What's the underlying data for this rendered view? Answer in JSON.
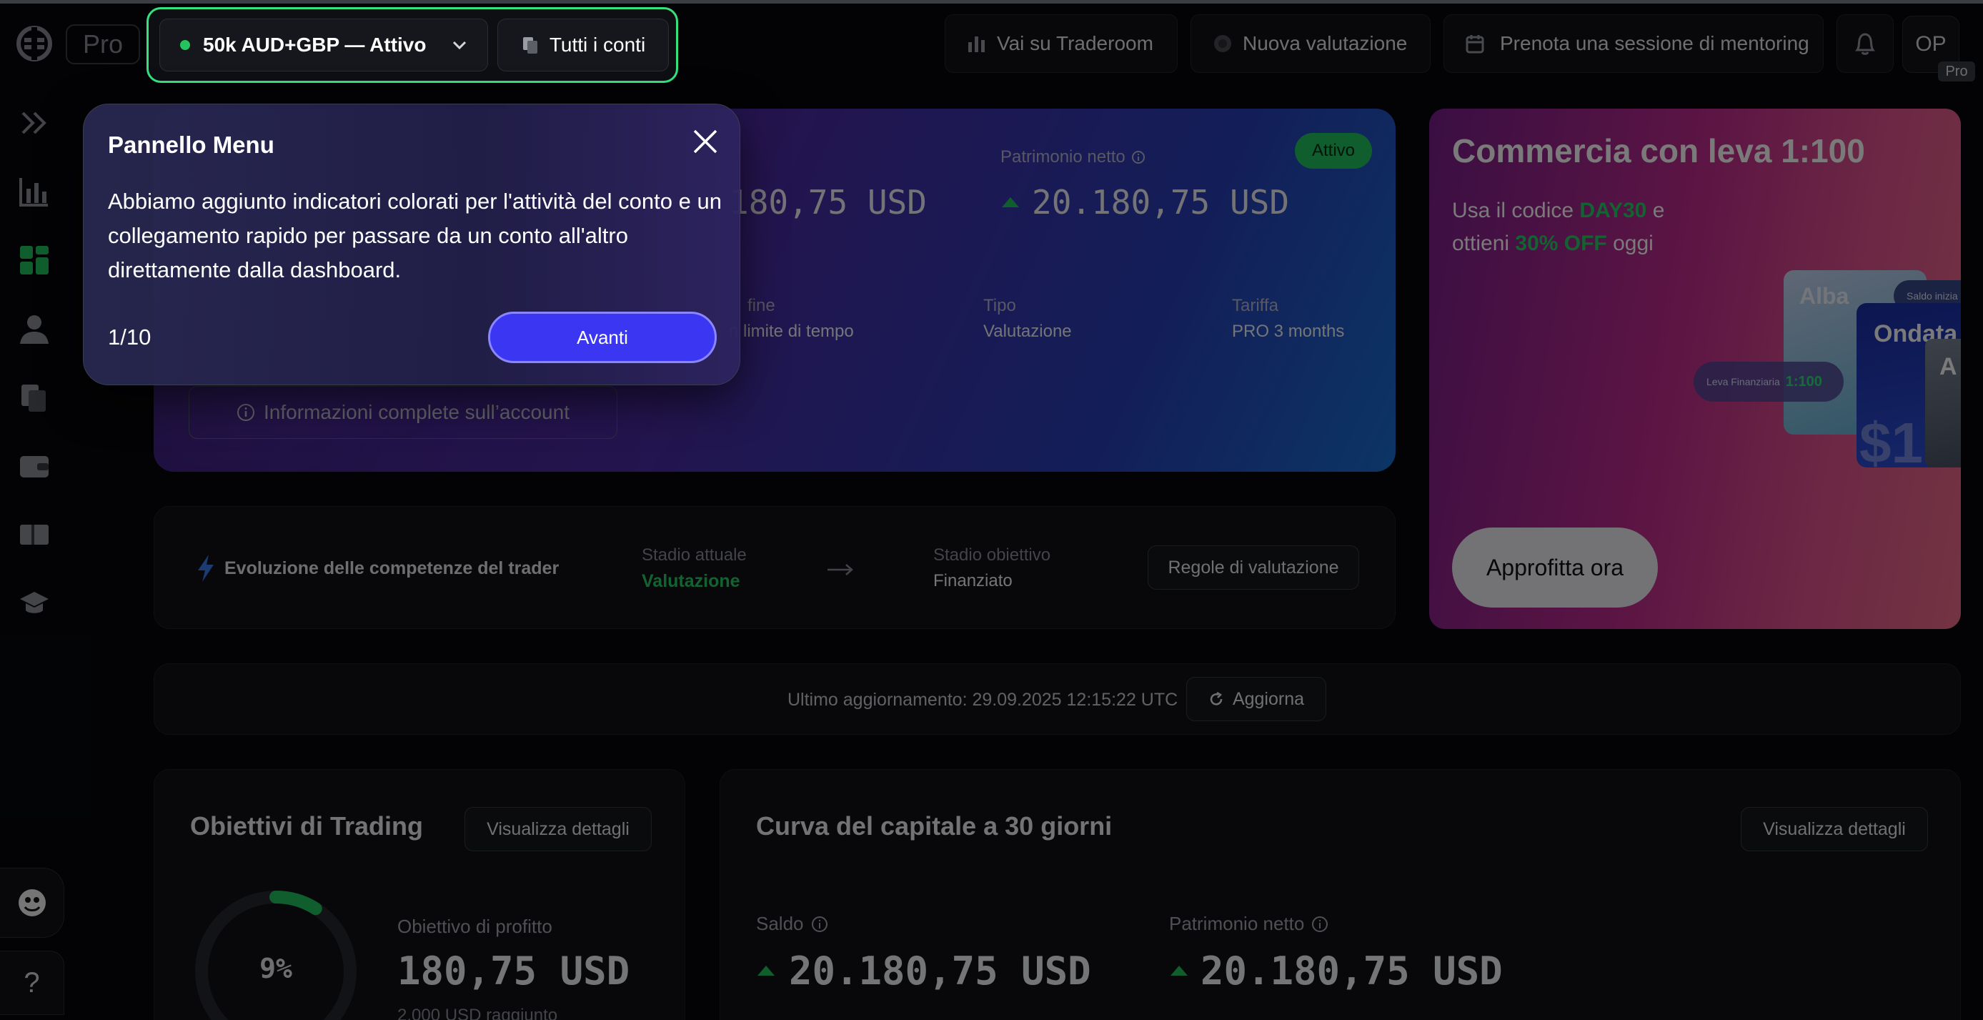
{
  "app": {
    "logo_pro": "Pro"
  },
  "header": {
    "account_selector": {
      "label": "50k AUD+GBP — Attivo",
      "status_color": "#23c45e"
    },
    "all_accounts_label": "Tutti i conti",
    "traderoom_label": "Vai su Traderoom",
    "new_evaluation_label": "Nuova valutazione",
    "mentoring_label": "Prenota una sessione di mentoring",
    "avatar_initials": "OP",
    "pro_badge": "Pro"
  },
  "sidebar": {
    "icons": [
      "expand-icon",
      "chart-icon",
      "dashboard-grid-icon",
      "user-icon",
      "accounts-icon",
      "wallet-icon",
      "card-icon",
      "graduation-cap-icon"
    ],
    "accent": "#23c45e"
  },
  "account_card": {
    "balance_partial": "180,75 USD",
    "equity_label": "Patrimonio netto",
    "equity_value": "20.180,75 USD",
    "status_badge": "Attivo",
    "end_label": "fine",
    "end_value": "n limite di tempo",
    "type_label": "Tipo",
    "type_value": "Valutazione",
    "tariff_label": "Tariffa",
    "tariff_value": "PRO 3 months",
    "info_button": "Informazioni complete sull’account"
  },
  "promo": {
    "title": "Commercia con leva 1:100",
    "line1_pre": "Usa il codice ",
    "code": "DAY30",
    "line1_post": " e",
    "line2_pre": "ottieni ",
    "discount": "30% OFF",
    "line2_post": " oggi",
    "card_alba": "Alba",
    "card_ondata": "Ondata",
    "card_third": "A",
    "dollar_text": "$1",
    "chip_leverage_label": "Leva Finanziaria",
    "chip_leverage_value": "1:100",
    "chip_balance": "Saldo inizia",
    "cta": "Approfitta ora"
  },
  "evolution": {
    "title": "Evoluzione delle competenze del trader",
    "current_stage_label": "Stadio attuale",
    "current_stage_value": "Valutazione",
    "target_stage_label": "Stadio obiettivo",
    "target_stage_value": "Finanziato",
    "rules_button": "Regole di valutazione"
  },
  "update_bar": {
    "last_update": "Ultimo aggiornamento: 29.09.2025 12:15:22 UTC",
    "refresh_button": "Aggiorna"
  },
  "objectives": {
    "title": "Obiettivi di Trading",
    "details_button": "Visualizza dettagli",
    "progress_percent": "9%",
    "progress_fraction": 0.09,
    "profit_label": "Obiettivo di profitto",
    "profit_value": "180,75 USD",
    "profit_sub": "2.000 USD raggiunto"
  },
  "equity_curve": {
    "title": "Curva del capitale a 30 giorni",
    "details_button": "Visualizza dettagli",
    "balance_label": "Saldo",
    "balance_value": "20.180,75 USD",
    "equity_label": "Patrimonio netto",
    "equity_value": "20.180,75 USD"
  },
  "tour_popover": {
    "title": "Pannello Menu",
    "body": "Abbiamo aggiunto indicatori colorati per l'attività del conto e un collegamento rapido per passare da un conto all'altro direttamente dalla dashboard.",
    "step": "1/10",
    "next_button": "Avanti"
  },
  "floating": {
    "help_label": "?"
  }
}
